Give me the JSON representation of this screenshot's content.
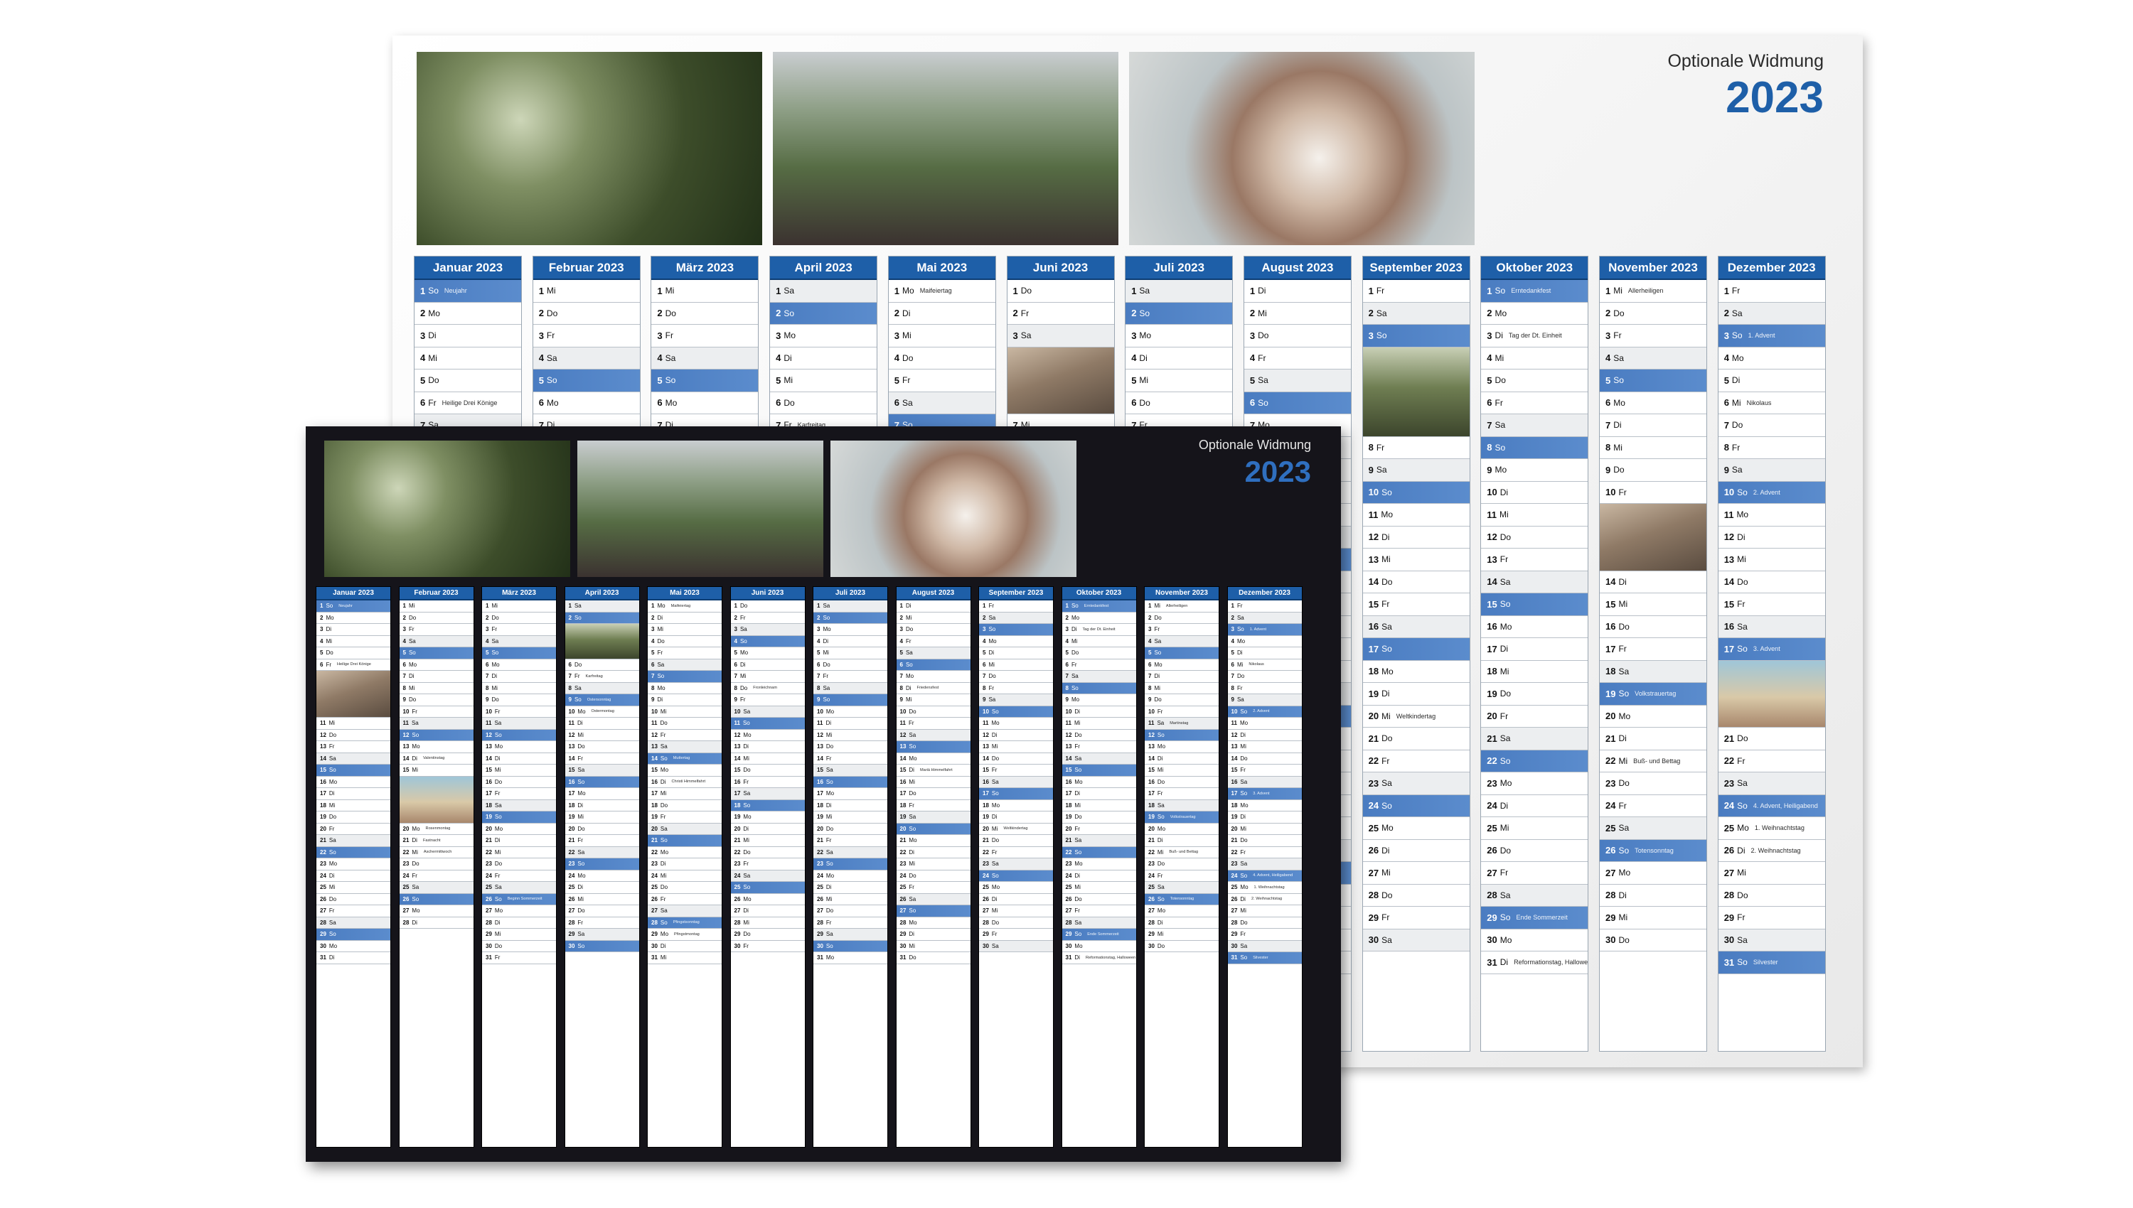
{
  "dedication": "Optionale Widmung",
  "year": "2023",
  "months": [
    {
      "name": "Januar 2023",
      "first": 0,
      "days": 31,
      "notes": {
        "1": "Neujahr",
        "6": "Heilige Drei Könige"
      }
    },
    {
      "name": "Februar 2023",
      "first": 3,
      "days": 28,
      "notes": {
        "14": "Valentinstag",
        "20": "Rosenmontag",
        "21": "Fastnacht",
        "22": "Aschermittwoch"
      }
    },
    {
      "name": "März 2023",
      "first": 3,
      "days": 31,
      "notes": {
        "10": "",
        "26": "Beginn Sommerzeit"
      }
    },
    {
      "name": "April 2023",
      "first": 6,
      "days": 30,
      "notes": {
        "7": "Karfreitag",
        "9": "Ostersonntag",
        "10": "Ostermontag"
      }
    },
    {
      "name": "Mai 2023",
      "first": 1,
      "days": 31,
      "notes": {
        "1": "Maifeiertag",
        "14": "Muttertag",
        "16": "Christi Himmelfahrt",
        "28": "Pfingstsonntag",
        "29": "Pfingstmontag"
      }
    },
    {
      "name": "Juni 2023",
      "first": 4,
      "days": 30,
      "notes": {
        "8": "Fronleichnam"
      }
    },
    {
      "name": "Juli 2023",
      "first": 6,
      "days": 31,
      "notes": {}
    },
    {
      "name": "August 2023",
      "first": 2,
      "days": 31,
      "notes": {
        "8": "Friedensfest",
        "15": "Mariä Himmelfahrt"
      }
    },
    {
      "name": "September 2023",
      "first": 5,
      "days": 30,
      "notes": {
        "20": "Weltkindertag"
      }
    },
    {
      "name": "Oktober 2023",
      "first": 0,
      "days": 31,
      "notes": {
        "1": "Erntedankfest",
        "3": "Tag der Dt. Einheit",
        "29": "Ende Sommerzeit",
        "31": "Reformationstag, Halloween"
      }
    },
    {
      "name": "November 2023",
      "first": 3,
      "days": 30,
      "notes": {
        "1": "Allerheiligen",
        "11": "Martinstag",
        "19": "Volkstrauertag",
        "22": "Buß- und Bettag",
        "26": "Totensonntag"
      }
    },
    {
      "name": "Dezember 2023",
      "first": 5,
      "days": 31,
      "notes": {
        "3": "1. Advent",
        "6": "Nikolaus",
        "10": "2. Advent",
        "17": "3. Advent",
        "24": "4. Advent, Heiligabend",
        "25": "1. Weihnachtstag",
        "26": "2. Weihnachtstag",
        "31": "Silvester"
      }
    }
  ],
  "weekday_abbr": [
    "So",
    "Mo",
    "Di",
    "Mi",
    "Do",
    "Fr",
    "Sa"
  ],
  "colors": {
    "accent": "#1e5fa8",
    "weekend": "#4a7cc1",
    "dark_bg": "#15141a"
  },
  "photos": [
    "family-photo",
    "couple-photo",
    "dog-photo"
  ]
}
